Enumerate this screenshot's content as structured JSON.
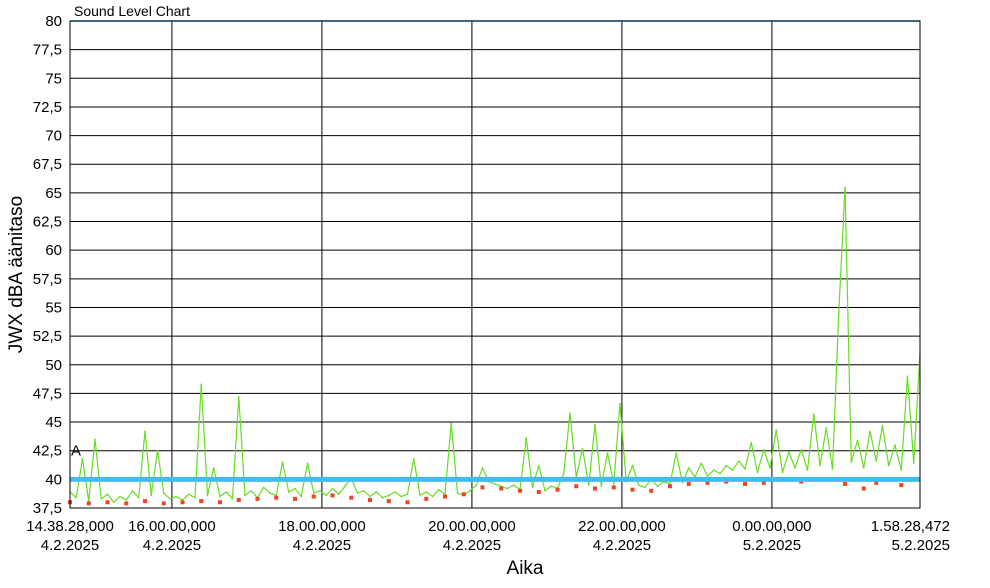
{
  "chart_data": {
    "type": "line",
    "title": "Sound Level Chart",
    "xlabel": "Aika",
    "ylabel": "JWX dBA äänitaso",
    "ylim": [
      37.5,
      80
    ],
    "yticks": [
      37.5,
      40,
      42.5,
      45,
      47.5,
      50,
      52.5,
      55,
      57.5,
      60,
      62.5,
      65,
      67.5,
      70,
      72.5,
      75,
      77.5,
      80
    ],
    "ytick_labels": [
      "37,5",
      "40",
      "42,5",
      "45",
      "47,5",
      "50",
      "52,5",
      "55",
      "57,5",
      "60",
      "62,5",
      "65",
      "67,5",
      "70",
      "72,5",
      "75",
      "77,5",
      "80"
    ],
    "xlim": [
      "4.2.2025 14:38:28",
      "5.2.2025 01:58:28"
    ],
    "xticks": [
      {
        "time": "4.2.2025 14:38:28",
        "line1": "14.38.28,000",
        "line2": "4.2.2025"
      },
      {
        "time": "4.2.2025 16:00:00",
        "line1": "16.00.00,000",
        "line2": "4.2.2025"
      },
      {
        "time": "4.2.2025 18:00:00",
        "line1": "18.00.00,000",
        "line2": "4.2.2025"
      },
      {
        "time": "4.2.2025 20:00:00",
        "line1": "20.00.00,000",
        "line2": "4.2.2025"
      },
      {
        "time": "4.2.2025 22:00:00",
        "line1": "22.00.00,000",
        "line2": "4.2.2025"
      },
      {
        "time": "5.2.2025 00:00:00",
        "line1": "0.00.00,000",
        "line2": "5.2.2025"
      },
      {
        "time": "5.2.2025 01:58:28",
        "line1": "1.58.28,472",
        "line2": "5.2.2025"
      }
    ],
    "grid": true,
    "threshold": {
      "value": 40,
      "color": "#44bbee"
    },
    "marker_label": "A",
    "series": [
      {
        "style": "line",
        "color": "#66dd22",
        "points": [
          [
            "4.2.2025 14:38:28",
            38.9
          ],
          [
            "4.2.2025 14:43:28",
            38.4
          ],
          [
            "4.2.2025 14:48:28",
            41.8
          ],
          [
            "4.2.2025 14:53:28",
            38.1
          ],
          [
            "4.2.2025 14:58:28",
            43.5
          ],
          [
            "4.2.2025 15:03:28",
            38.3
          ],
          [
            "4.2.2025 15:08:28",
            38.7
          ],
          [
            "4.2.2025 15:13:28",
            38.0
          ],
          [
            "4.2.2025 15:18:28",
            38.5
          ],
          [
            "4.2.2025 15:23:28",
            38.2
          ],
          [
            "4.2.2025 15:28:28",
            39.0
          ],
          [
            "4.2.2025 15:33:28",
            38.4
          ],
          [
            "4.2.2025 15:38:28",
            44.2
          ],
          [
            "4.2.2025 15:43:28",
            38.6
          ],
          [
            "4.2.2025 15:48:28",
            42.5
          ],
          [
            "4.2.2025 15:53:28",
            38.8
          ],
          [
            "4.2.2025 15:58:28",
            38.3
          ],
          [
            "4.2.2025 16:03:28",
            38.5
          ],
          [
            "4.2.2025 16:08:28",
            38.2
          ],
          [
            "4.2.2025 16:13:28",
            38.7
          ],
          [
            "4.2.2025 16:18:28",
            38.4
          ],
          [
            "4.2.2025 16:23:28",
            48.3
          ],
          [
            "4.2.2025 16:28:28",
            38.6
          ],
          [
            "4.2.2025 16:33:28",
            41.0
          ],
          [
            "4.2.2025 16:38:28",
            38.5
          ],
          [
            "4.2.2025 16:43:28",
            38.9
          ],
          [
            "4.2.2025 16:48:28",
            38.3
          ],
          [
            "4.2.2025 16:53:28",
            47.2
          ],
          [
            "4.2.2025 16:58:28",
            38.6
          ],
          [
            "4.2.2025 17:03:28",
            39.0
          ],
          [
            "4.2.2025 17:08:28",
            38.4
          ],
          [
            "4.2.2025 17:13:28",
            39.3
          ],
          [
            "4.2.2025 17:18:28",
            38.8
          ],
          [
            "4.2.2025 17:23:28",
            38.6
          ],
          [
            "4.2.2025 17:28:28",
            41.5
          ],
          [
            "4.2.2025 17:33:28",
            38.9
          ],
          [
            "4.2.2025 17:38:28",
            39.2
          ],
          [
            "4.2.2025 17:43:28",
            38.5
          ],
          [
            "4.2.2025 17:48:28",
            41.4
          ],
          [
            "4.2.2025 17:53:28",
            38.8
          ],
          [
            "4.2.2025 17:58:28",
            39.0
          ],
          [
            "4.2.2025 18:03:28",
            38.6
          ],
          [
            "4.2.2025 18:08:28",
            39.2
          ],
          [
            "4.2.2025 18:13:28",
            38.7
          ],
          [
            "4.2.2025 18:18:28",
            39.4
          ],
          [
            "4.2.2025 18:23:28",
            40.1
          ],
          [
            "4.2.2025 18:28:28",
            38.8
          ],
          [
            "4.2.2025 18:33:28",
            39.0
          ],
          [
            "4.2.2025 18:38:28",
            38.5
          ],
          [
            "4.2.2025 18:43:28",
            38.9
          ],
          [
            "4.2.2025 18:48:28",
            38.4
          ],
          [
            "4.2.2025 18:53:28",
            38.6
          ],
          [
            "4.2.2025 18:58:28",
            38.9
          ],
          [
            "4.2.2025 19:03:28",
            38.5
          ],
          [
            "4.2.2025 19:08:28",
            38.7
          ],
          [
            "4.2.2025 19:13:28",
            41.8
          ],
          [
            "4.2.2025 19:18:28",
            38.6
          ],
          [
            "4.2.2025 19:23:28",
            38.9
          ],
          [
            "4.2.2025 19:28:28",
            38.5
          ],
          [
            "4.2.2025 19:33:28",
            39.1
          ],
          [
            "4.2.2025 19:38:28",
            38.7
          ],
          [
            "4.2.2025 19:43:28",
            44.9
          ],
          [
            "4.2.2025 19:48:28",
            38.8
          ],
          [
            "4.2.2025 19:53:28",
            38.6
          ],
          [
            "4.2.2025 19:58:28",
            39.0
          ],
          [
            "4.2.2025 20:03:28",
            39.5
          ],
          [
            "4.2.2025 20:08:28",
            41.0
          ],
          [
            "4.2.2025 20:13:28",
            39.8
          ],
          [
            "4.2.2025 20:18:28",
            39.6
          ],
          [
            "4.2.2025 20:23:28",
            39.4
          ],
          [
            "4.2.2025 20:28:28",
            39.2
          ],
          [
            "4.2.2025 20:33:28",
            39.5
          ],
          [
            "4.2.2025 20:38:28",
            39.1
          ],
          [
            "4.2.2025 20:43:28",
            43.6
          ],
          [
            "4.2.2025 20:48:28",
            39.3
          ],
          [
            "4.2.2025 20:53:28",
            41.2
          ],
          [
            "4.2.2025 20:58:28",
            39.0
          ],
          [
            "4.2.2025 21:03:28",
            39.4
          ],
          [
            "4.2.2025 21:08:28",
            39.2
          ],
          [
            "4.2.2025 21:13:28",
            40.5
          ],
          [
            "4.2.2025 21:18:28",
            45.8
          ],
          [
            "4.2.2025 21:23:28",
            40.2
          ],
          [
            "4.2.2025 21:28:28",
            42.7
          ],
          [
            "4.2.2025 21:33:28",
            39.5
          ],
          [
            "4.2.2025 21:38:28",
            44.8
          ],
          [
            "4.2.2025 21:43:28",
            39.4
          ],
          [
            "4.2.2025 21:48:28",
            42.3
          ],
          [
            "4.2.2025 21:53:28",
            39.6
          ],
          [
            "4.2.2025 21:58:28",
            46.6
          ],
          [
            "4.2.2025 22:03:28",
            39.8
          ],
          [
            "4.2.2025 22:08:28",
            41.2
          ],
          [
            "4.2.2025 22:13:28",
            39.5
          ],
          [
            "4.2.2025 22:18:28",
            39.3
          ],
          [
            "4.2.2025 22:23:28",
            40.0
          ],
          [
            "4.2.2025 22:28:28",
            39.4
          ],
          [
            "4.2.2025 22:33:28",
            39.8
          ],
          [
            "4.2.2025 22:38:28",
            39.6
          ],
          [
            "4.2.2025 22:43:28",
            42.3
          ],
          [
            "4.2.2025 22:48:28",
            39.7
          ],
          [
            "4.2.2025 22:53:28",
            41.0
          ],
          [
            "4.2.2025 22:58:28",
            40.2
          ],
          [
            "4.2.2025 23:03:28",
            41.4
          ],
          [
            "4.2.2025 23:08:28",
            40.3
          ],
          [
            "4.2.2025 23:13:28",
            40.8
          ],
          [
            "4.2.2025 23:18:28",
            40.5
          ],
          [
            "4.2.2025 23:23:28",
            41.2
          ],
          [
            "4.2.2025 23:28:28",
            40.8
          ],
          [
            "4.2.2025 23:33:28",
            41.6
          ],
          [
            "4.2.2025 23:38:28",
            40.9
          ],
          [
            "4.2.2025 23:43:28",
            43.2
          ],
          [
            "4.2.2025 23:48:28",
            40.6
          ],
          [
            "4.2.2025 23:53:28",
            42.6
          ],
          [
            "4.2.2025 23:58:28",
            41.0
          ],
          [
            "5.2.2025 00:03:28",
            44.3
          ],
          [
            "5.2.2025 00:08:28",
            40.6
          ],
          [
            "5.2.2025 00:13:28",
            42.4
          ],
          [
            "5.2.2025 00:18:28",
            41.0
          ],
          [
            "5.2.2025 00:23:28",
            42.6
          ],
          [
            "5.2.2025 00:28:28",
            40.8
          ],
          [
            "5.2.2025 00:33:28",
            45.7
          ],
          [
            "5.2.2025 00:38:28",
            41.2
          ],
          [
            "5.2.2025 00:43:28",
            44.5
          ],
          [
            "5.2.2025 00:48:28",
            40.9
          ],
          [
            "5.2.2025 00:53:28",
            54.5
          ],
          [
            "5.2.2025 00:58:28",
            65.5
          ],
          [
            "5.2.2025 01:03:28",
            41.5
          ],
          [
            "5.2.2025 01:08:28",
            43.4
          ],
          [
            "5.2.2025 01:13:28",
            41.0
          ],
          [
            "5.2.2025 01:18:28",
            44.2
          ],
          [
            "5.2.2025 01:23:28",
            41.6
          ],
          [
            "5.2.2025 01:28:28",
            44.7
          ],
          [
            "5.2.2025 01:33:28",
            41.2
          ],
          [
            "5.2.2025 01:38:28",
            43.0
          ],
          [
            "5.2.2025 01:43:28",
            40.8
          ],
          [
            "5.2.2025 01:48:28",
            49.0
          ],
          [
            "5.2.2025 01:53:28",
            41.4
          ],
          [
            "5.2.2025 01:58:28",
            51.0
          ]
        ]
      },
      {
        "style": "markers",
        "color": "#ee4422",
        "points": [
          [
            "4.2.2025 14:38:28",
            38.0
          ],
          [
            "4.2.2025 14:53:28",
            37.9
          ],
          [
            "4.2.2025 15:08:28",
            38.0
          ],
          [
            "4.2.2025 15:23:28",
            37.9
          ],
          [
            "4.2.2025 15:38:28",
            38.1
          ],
          [
            "4.2.2025 15:53:28",
            37.9
          ],
          [
            "4.2.2025 16:08:28",
            38.0
          ],
          [
            "4.2.2025 16:23:28",
            38.1
          ],
          [
            "4.2.2025 16:38:28",
            38.0
          ],
          [
            "4.2.2025 16:53:28",
            38.2
          ],
          [
            "4.2.2025 17:08:28",
            38.3
          ],
          [
            "4.2.2025 17:23:28",
            38.4
          ],
          [
            "4.2.2025 17:38:28",
            38.3
          ],
          [
            "4.2.2025 17:53:28",
            38.5
          ],
          [
            "4.2.2025 18:08:28",
            38.6
          ],
          [
            "4.2.2025 18:23:28",
            38.4
          ],
          [
            "4.2.2025 18:38:28",
            38.2
          ],
          [
            "4.2.2025 18:53:28",
            38.1
          ],
          [
            "4.2.2025 19:08:28",
            38.0
          ],
          [
            "4.2.2025 19:23:28",
            38.3
          ],
          [
            "4.2.2025 19:38:28",
            38.5
          ],
          [
            "4.2.2025 19:53:28",
            38.7
          ],
          [
            "4.2.2025 20:08:28",
            39.3
          ],
          [
            "4.2.2025 20:23:28",
            39.2
          ],
          [
            "4.2.2025 20:38:28",
            39.0
          ],
          [
            "4.2.2025 20:53:28",
            38.9
          ],
          [
            "4.2.2025 21:08:28",
            39.1
          ],
          [
            "4.2.2025 21:23:28",
            39.4
          ],
          [
            "4.2.2025 21:38:28",
            39.2
          ],
          [
            "4.2.2025 21:53:28",
            39.3
          ],
          [
            "4.2.2025 22:08:28",
            39.1
          ],
          [
            "4.2.2025 22:23:28",
            39.0
          ],
          [
            "4.2.2025 22:38:28",
            39.4
          ],
          [
            "4.2.2025 22:53:28",
            39.6
          ],
          [
            "4.2.2025 23:08:28",
            39.7
          ],
          [
            "4.2.2025 23:23:28",
            39.8
          ],
          [
            "4.2.2025 23:38:28",
            39.6
          ],
          [
            "4.2.2025 23:53:28",
            39.7
          ],
          [
            "5.2.2025 00:23:28",
            39.8
          ],
          [
            "5.2.2025 00:58:28",
            39.6
          ],
          [
            "5.2.2025 01:13:28",
            39.2
          ],
          [
            "5.2.2025 01:23:28",
            39.7
          ],
          [
            "5.2.2025 01:43:28",
            39.5
          ]
        ]
      }
    ]
  }
}
